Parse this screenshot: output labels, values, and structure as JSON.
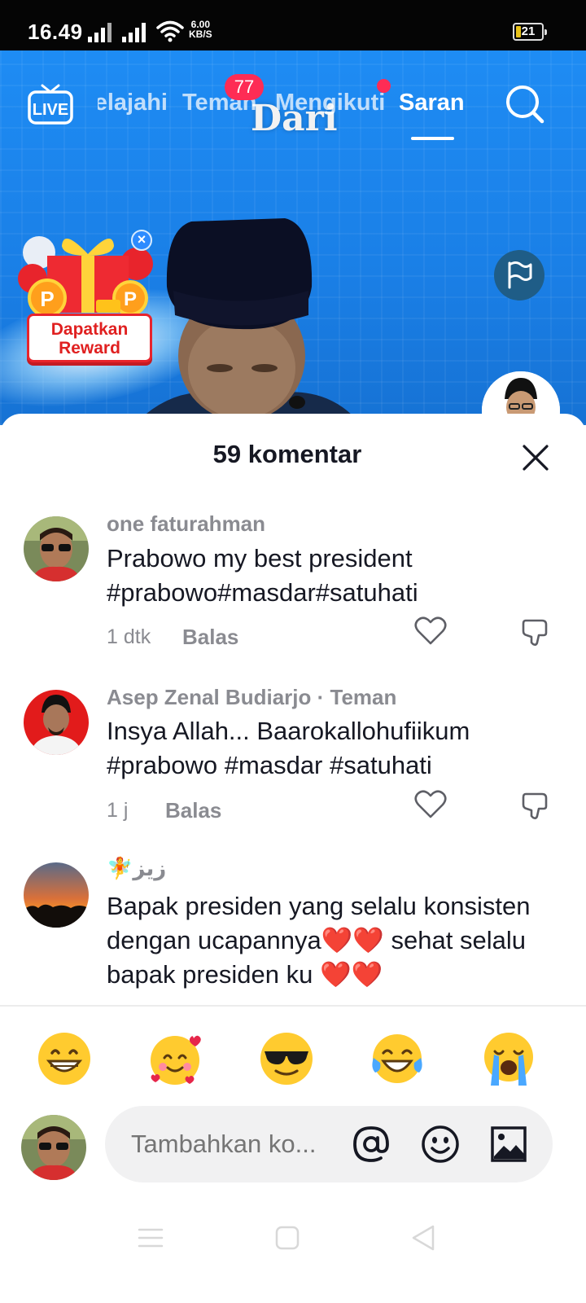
{
  "status_bar": {
    "time": "16.49",
    "net_speed_value": "6.00",
    "net_speed_unit": "KB/S",
    "battery_level": "21",
    "battery_fraction": 0.21
  },
  "video": {
    "caption_text": "Dari"
  },
  "top_nav": {
    "live_label": "LIVE",
    "tabs": [
      {
        "label": "Jelajahi"
      },
      {
        "label": "Teman"
      },
      {
        "label": "Mengikuti"
      },
      {
        "label": "Saran"
      }
    ],
    "active_tab": "Saran",
    "friends_badge": "77"
  },
  "reward_widget": {
    "label_line1": "Dapatkan",
    "label_line2": "Reward",
    "close_glyph": "×"
  },
  "comments_sheet": {
    "title": "59 komentar",
    "comments": [
      {
        "username": "one faturahman",
        "text": "Prabowo my best president #prabowo#masdar#satuhati",
        "time": "1 dtk",
        "reply_label": "Balas"
      },
      {
        "username": "Asep Zenal Budiarjo · Teman",
        "text": "Insya Allah... Baarokallohufiikum #prabowo #masdar #satuhati",
        "time": "1 j",
        "reply_label": "Balas"
      },
      {
        "username": "🧚زيز",
        "text": "Bapak presiden yang selalu konsisten dengan ucapannya❤️❤️ sehat selalu bapak presiden ku ❤️❤️",
        "time": "",
        "reply_label": ""
      }
    ],
    "quick_emojis": [
      "grinning-face",
      "smiling-face-with-hearts",
      "sunglasses-face",
      "tears-of-joy-face",
      "loudly-crying-face"
    ]
  },
  "composer": {
    "placeholder": "Tambahkan ko..."
  },
  "colors": {
    "accent": "#fe2c55",
    "video_blue": "#1e8cf4",
    "text_primary": "#161823",
    "text_secondary": "#8a8b91"
  }
}
